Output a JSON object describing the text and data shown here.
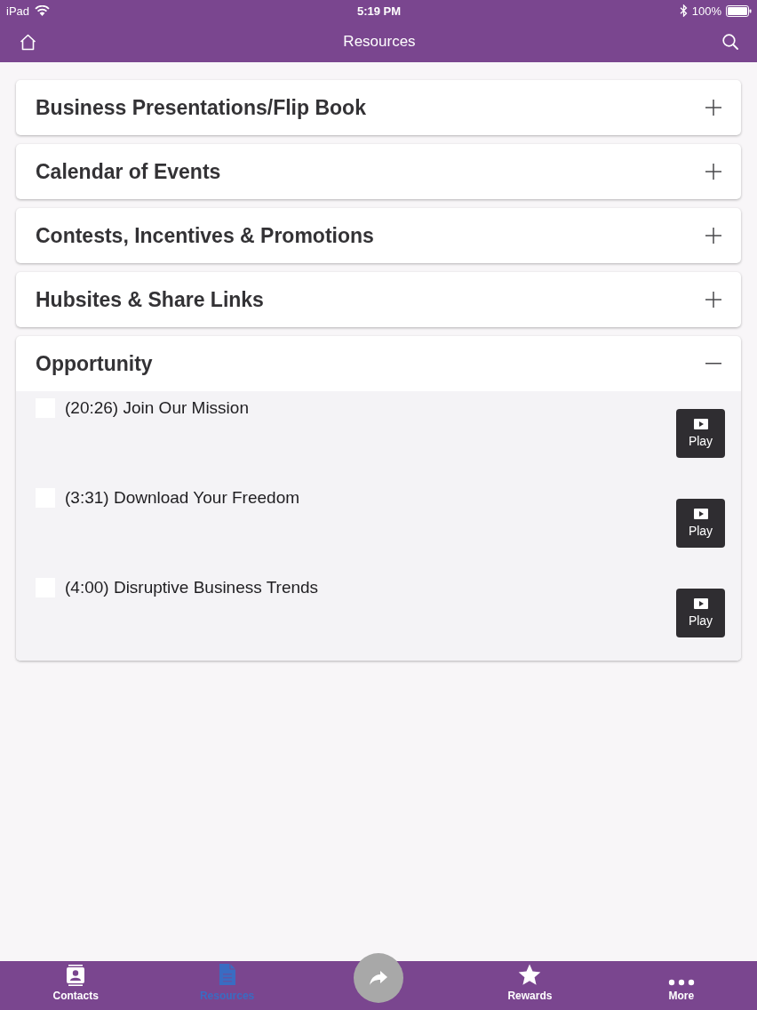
{
  "status_bar": {
    "device": "iPad",
    "time": "5:19 PM",
    "battery": "100%"
  },
  "nav_bar": {
    "title": "Resources"
  },
  "sections": [
    {
      "title": "Business Presentations/Flip Book",
      "expanded": false
    },
    {
      "title": "Calendar of Events",
      "expanded": false
    },
    {
      "title": "Contests, Incentives & Promotions",
      "expanded": false
    },
    {
      "title": "Hubsites & Share Links",
      "expanded": false
    },
    {
      "title": "Opportunity",
      "expanded": true,
      "items": [
        {
          "title": "(20:26) Join Our Mission",
          "checked": false,
          "button_label": "Play"
        },
        {
          "title": "(3:31) Download Your Freedom",
          "checked": false,
          "button_label": "Play"
        },
        {
          "title": "(4:00) Disruptive Business Trends",
          "checked": false,
          "button_label": "Play"
        }
      ]
    }
  ],
  "tab_bar": {
    "tabs": [
      {
        "label": "Contacts",
        "selected": false
      },
      {
        "label": "Resources",
        "selected": true
      },
      {
        "label": "Rewards",
        "selected": false
      },
      {
        "label": "More",
        "selected": false
      }
    ]
  }
}
